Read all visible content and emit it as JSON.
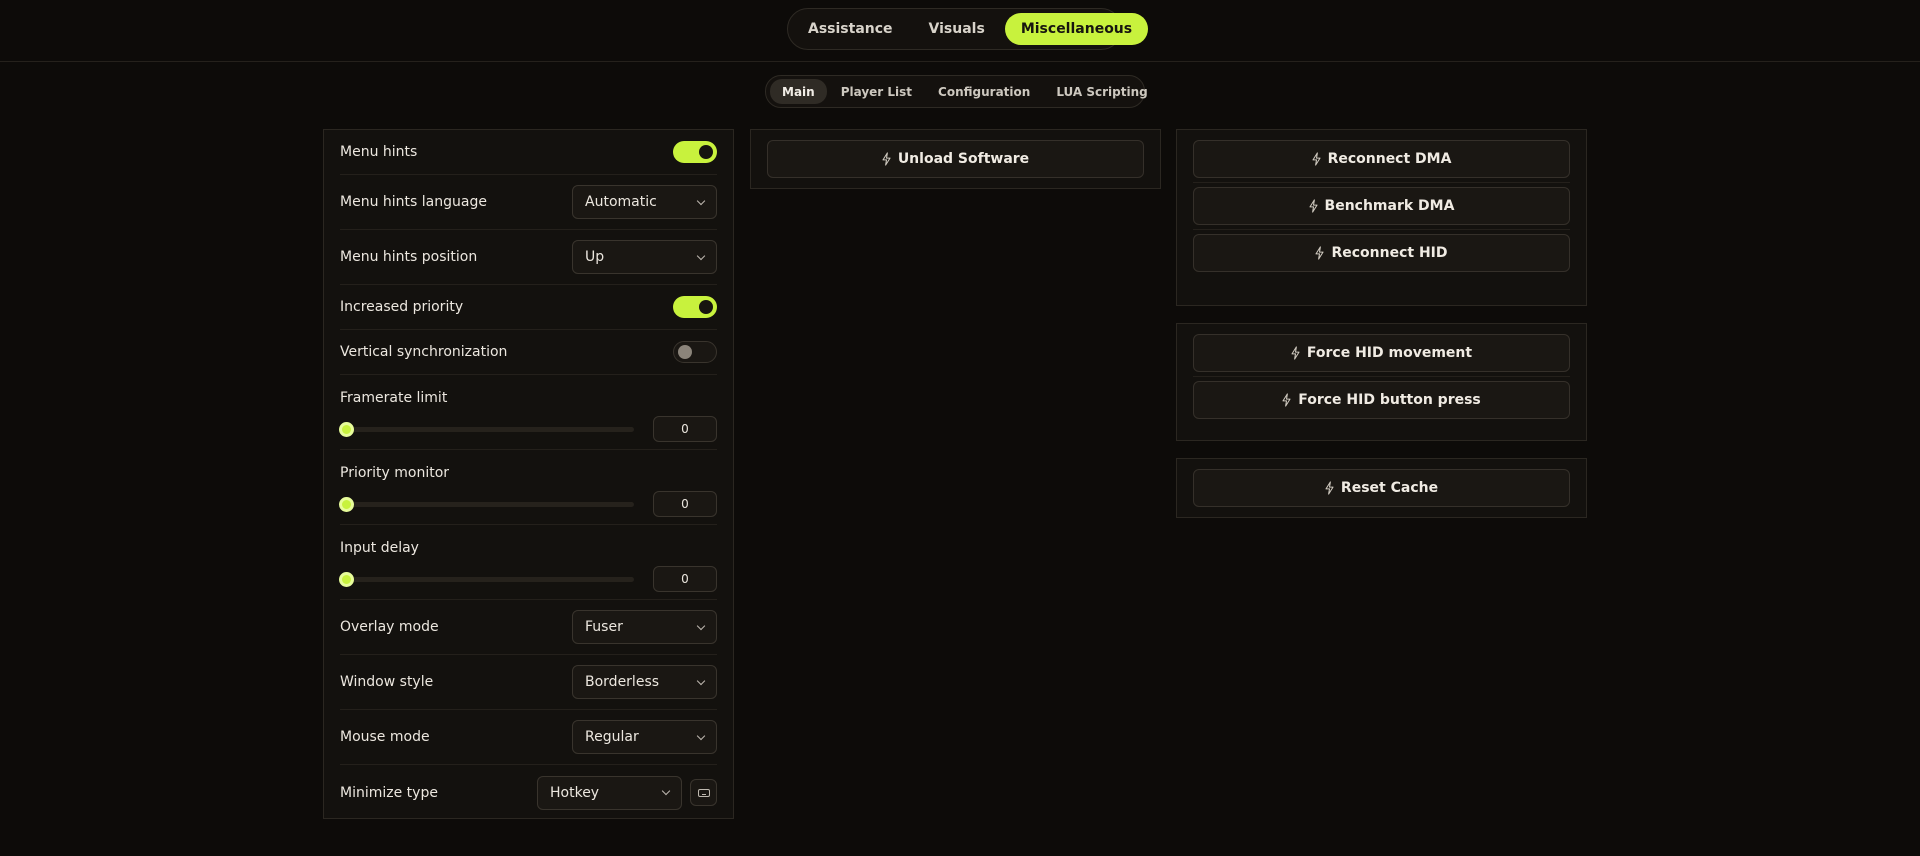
{
  "main_tabs": [
    {
      "label": "Assistance",
      "active": false
    },
    {
      "label": "Visuals",
      "active": false
    },
    {
      "label": "Miscellaneous",
      "active": true
    }
  ],
  "sub_tabs": [
    {
      "label": "Main",
      "active": true
    },
    {
      "label": "Player List",
      "active": false
    },
    {
      "label": "Configuration",
      "active": false
    },
    {
      "label": "LUA Scripting",
      "active": false
    }
  ],
  "settings": {
    "menu_hints": {
      "label": "Menu hints",
      "enabled": true
    },
    "menu_hints_language": {
      "label": "Menu hints language",
      "value": "Automatic"
    },
    "menu_hints_position": {
      "label": "Menu hints position",
      "value": "Up"
    },
    "increased_priority": {
      "label": "Increased priority",
      "enabled": true
    },
    "vertical_sync": {
      "label": "Vertical synchronization",
      "enabled": false
    },
    "framerate_limit": {
      "label": "Framerate limit",
      "value": "0"
    },
    "priority_monitor": {
      "label": "Priority monitor",
      "value": "0"
    },
    "input_delay": {
      "label": "Input delay",
      "value": "0"
    },
    "overlay_mode": {
      "label": "Overlay mode",
      "value": "Fuser"
    },
    "window_style": {
      "label": "Window style",
      "value": "Borderless"
    },
    "mouse_mode": {
      "label": "Mouse mode",
      "value": "Regular"
    },
    "minimize_type": {
      "label": "Minimize type",
      "value": "Hotkey"
    }
  },
  "actions": {
    "unload": "Unload Software",
    "reconnect_dma": "Reconnect DMA",
    "benchmark_dma": "Benchmark DMA",
    "reconnect_hid": "Reconnect HID",
    "force_hid_movement": "Force HID movement",
    "force_hid_button_press": "Force HID button press",
    "reset_cache": "Reset Cache"
  },
  "colors": {
    "accent": "#c8f23d",
    "background": "#0d0b09",
    "panel": "#13110e"
  }
}
